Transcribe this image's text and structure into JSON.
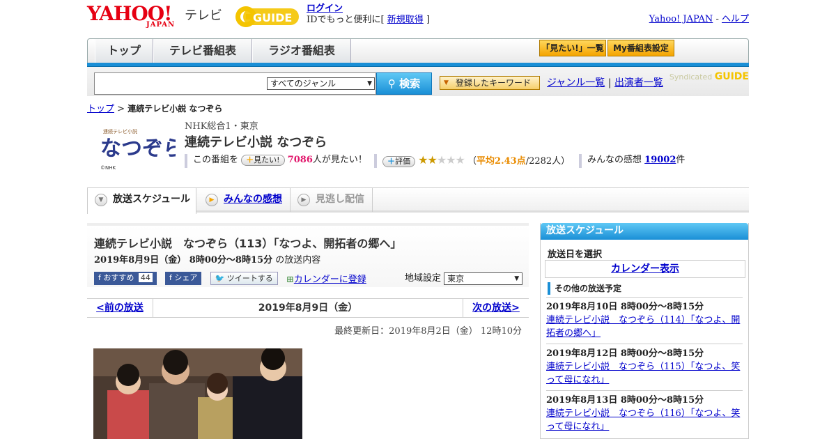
{
  "header": {
    "logo_yahoo": "YAHOO!",
    "logo_japan": "JAPAN",
    "logo_tv": "テレビ",
    "gguide": "GUIDE",
    "login": "ログイン",
    "login_sub": "IDでもっと便利に[",
    "signup": "新規取得",
    "close_bracket": "]",
    "yahoo_japan": "Yahoo! JAPAN",
    "sep": "-",
    "help": "ヘルプ"
  },
  "nav": {
    "tabs": [
      "トップ",
      "テレビ番組表",
      "ラジオ番組表"
    ],
    "mitai_list": "「見たい!」一覧",
    "my_schedule": "My番組表設定"
  },
  "search": {
    "genre_select": "すべてのジャンル",
    "search_button": "検索",
    "keywords": "登録したキーワード",
    "genre_list": "ジャンル一覧",
    "pipe": "|",
    "performer_list": "出演者一覧",
    "syndicated": "Syndicated",
    "syndicated_brand": "GUIDE"
  },
  "breadcrumb": {
    "top": "トップ",
    "sep": ">",
    "current": "連続テレビ小説 なつぞら"
  },
  "program": {
    "logo_text": "なつぞら",
    "logo_sub": "連続テレビ小説",
    "logo_copy": "©NHK",
    "channel": "NHK総合1・東京",
    "title": "連続テレビ小説 なつぞら",
    "watch_prefix": "この番組を",
    "watch_btn": "見たい!",
    "watch_count": "7086",
    "watch_suffix": "人が見たい！",
    "rate_btn": "評価",
    "rating_avg_label": "平均",
    "rating_avg": "2.43点",
    "rating_count": "/2282人）",
    "rating_open": "（",
    "rating_stars": 2.43,
    "impressions_label": "みんなの感想",
    "impressions_count": "19002",
    "impressions_unit": "件"
  },
  "tabs": [
    {
      "label": "放送スケジュール"
    },
    {
      "label": "みんなの感想"
    },
    {
      "label": "見逃し配信"
    }
  ],
  "episode": {
    "title": "連続テレビ小説　なつぞら（113）「なつよ、開拓者の郷へ」",
    "date": "2019年8月9日（金）  8時00分～8時15分",
    "date_suffix": "の放送内容",
    "recommend": "おすすめ",
    "recommend_count": "44",
    "share": "シェア",
    "tweet": "ツイートする",
    "calendar": "カレンダーに登録",
    "region_label": "地域設定",
    "region_value": "東京",
    "prev": "<前の放送",
    "current_date": "2019年8月9日（金）",
    "next": "次の放送>",
    "updated": "最終更新日：2019年8月2日（金）  12時10分"
  },
  "sidebar": {
    "title": "放送スケジュール",
    "select_day": "放送日を選択",
    "calendar": "カレンダー表示",
    "other": "その他の放送予定",
    "items": [
      {
        "time": "2019年8月10日  8時00分～8時15分",
        "title": "連続テレビ小説　なつぞら（114）「なつよ、開拓者の郷へ」"
      },
      {
        "time": "2019年8月12日  8時00分～8時15分",
        "title": "連続テレビ小説　なつぞら（115）「なつよ、笑って母になれ」"
      },
      {
        "time": "2019年8月13日  8時00分～8時15分",
        "title": "連続テレビ小説　なつぞら（116）「なつよ、笑って母になれ」"
      }
    ]
  },
  "colors": {
    "accent_blue": "#1a8fd6",
    "yahoo_red": "#e60012",
    "link": "#0000cc",
    "pink": "#e1166b",
    "gold": "#f4a400"
  }
}
